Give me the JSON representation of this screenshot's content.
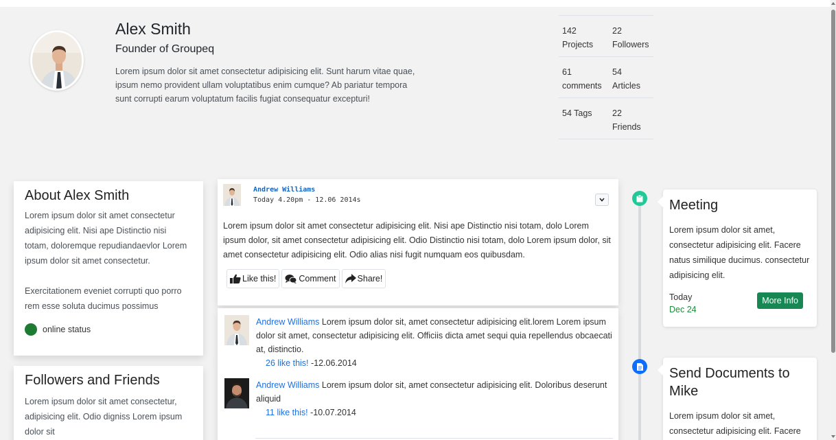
{
  "profile": {
    "name": "Alex Smith",
    "title": "Founder of Groupeq",
    "bio": "Lorem ipsum dolor sit amet consectetur adipisicing elit. Sunt harum vitae quae, ipsum nemo provident ullam voluptatibus enim cumque? Ab pariatur tempora sunt corrupti earum voluptatum facilis fugiat consequatur excepturi!",
    "stats": [
      [
        {
          "num": "142",
          "label": "Projects"
        },
        {
          "num": "22",
          "label": "Followers"
        }
      ],
      [
        {
          "num": "61",
          "label": "comments"
        },
        {
          "num": "54",
          "label": "Articles"
        }
      ],
      [
        {
          "num": "54",
          "label": "Tags"
        },
        {
          "num": "22",
          "label": "Friends"
        }
      ]
    ]
  },
  "about": {
    "title": "About Alex Smith",
    "p1": "Lorem ipsum dolor sit amet consectetur adipisicing elit. Nisi ape Distinctio nisi totam, doloremque repudiandaevlor Lorem ipsum dolor sit amet consectetur.",
    "p2": "Exercitationem eveniet corrupti quo porro rem esse soluta ducimus possimus",
    "status": "online status",
    "status_color": "#1e7b34"
  },
  "followers": {
    "title": "Followers and Friends",
    "text": "Lorem ipsum dolor sit amet consectetur, adipisicing elit. Odio digniss Lorem ipsum dolor sit"
  },
  "post": {
    "author": "Andrew Williams",
    "time": "Today 4.20pm - 12.06 2014s",
    "body": "Lorem ipsum dolor sit amet consectetur adipisicing elit. Nisi ape Distinctio nisi totam, dolo Lorem ipsum dolor, sit amet consectetur adipisicing elit. Odio Distinctio nisi totam, dolo Lorem ipsum dolor, sit amet consectetur adipisicing elit. Odio alias nisi fugit numquam eos quibusdam.",
    "actions": {
      "like": "Like this!",
      "comment": "Comment",
      "share": "Share!"
    }
  },
  "comments": [
    {
      "author": "Andrew Williams",
      "text": " Lorem ipsum dolor sit, amet consectetur adipisicing elit.lorem Lorem ipsum dolor sit amet, consectetur adipisicing elit. Officiis dicta amet sequi quia repellendus obcaecati at, distinctio.",
      "likes": "26 like this!",
      "date": " -12.06.2014"
    },
    {
      "author": "Andrew Williams",
      "text": " Lorem ipsum dolor sit, amet consectetur adipisicing elit. Doloribus deserunt aliquid",
      "likes": "11 like this!",
      "date": " -10.07.2014"
    }
  ],
  "timeline": [
    {
      "title": "Meeting",
      "text": "Lorem ipsum dolor sit amet, consectetur adipisicing elit. Facere natus similique ducimus. consectetur adipisicing elit.",
      "day": "Today",
      "date": "Dec 24",
      "button": "More Info",
      "icon": "clipboard-icon",
      "color": "#20c997"
    },
    {
      "title": "Send Documents to Mike",
      "text": "Lorem ipsum dolor sit amet, consectetur adipisicing elit. Facere",
      "icon": "document-icon",
      "color": "#0d6efd"
    }
  ]
}
